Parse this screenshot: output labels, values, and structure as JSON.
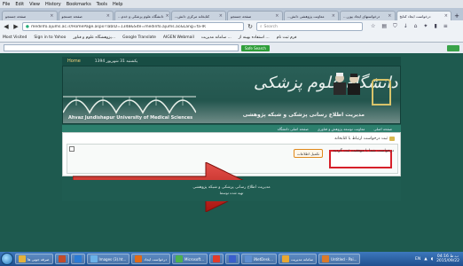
{
  "menu": [
    "File",
    "Edit",
    "View",
    "History",
    "Bookmarks",
    "Tools",
    "Help"
  ],
  "tabs": [
    {
      "label": "صفحه جستجو",
      "active": false
    },
    {
      "label": "صفحه جستجو",
      "active": false
    },
    {
      "label": "...دانشگاه علوم پزشکی و خدم",
      "active": false
    },
    {
      "label": "...کتابخانه مرکزی دانش",
      "active": false
    },
    {
      "label": "صفحه جستجو",
      "active": false
    },
    {
      "label": "...معاونت پژوهشی دانش",
      "active": false
    },
    {
      "label": "...درخواستهای ایجاد یوزر",
      "active": false
    },
    {
      "label": "درخواست ایجاد کتابخ",
      "active": true
    }
  ],
  "tab_new": "+",
  "url": "medinfo.ajums.ac.ir/HomePage.aspx?TabID=1348&Site=medinfo.ajums.ac&Lang=fa-IR",
  "url_host": "medinfo.ajums.ac.ir",
  "search_placeholder": "Search",
  "bookmarks": [
    "Most Visited",
    "Sign in to Yahoo",
    "پژوهشگاه علوم و فناور...",
    "Google Translate",
    "AIGEN Webmail",
    "سامانه مدیریت ...",
    "استفاده بهینه از ...",
    "فرم ثبت نام"
  ],
  "safe_search": "Safe Search",
  "page": {
    "top_strip_home": "Home",
    "date": "یکشنبه 31 شهریور 1394",
    "banner_en": "Ahvaz Jundishapur University of Medical Sciences",
    "banner_fa": "مدیریت اطلاع رسانی پزشکی و شبکه پژوهشی",
    "calligraphy": "دانشگاه علوم پزشکی",
    "nav": [
      "صفحه اصلی",
      "معاونت توسعه پژوهش و فناوری",
      "صفحه اصلی دانشگاه"
    ],
    "breadcrumb": "ثبت درخواست ارتباط با کتابخانه",
    "message": "درخواست شما با موفقیت ثبت گردید",
    "info_button": "تکمیل اطلاعات",
    "footer_line1": "مدیریت اطلاع رسانی پزشکی و شبکه پژوهشی",
    "footer_line2": "تهیه شده توسط"
  },
  "taskbar": {
    "items": [
      {
        "label": "صرفه جویی ها",
        "color": "#e5b23a"
      },
      {
        "label": "",
        "color": "#c24c2a"
      },
      {
        "label": "",
        "color": "#2b7bd5"
      },
      {
        "label": "Images (3).ht...",
        "color": "#6bb2e8"
      },
      {
        "label": "درخواست ایجاد",
        "color": "#e06b18"
      },
      {
        "label": "Microsoft...",
        "color": "#4caf50"
      },
      {
        "label": "",
        "color": "#e23b2b"
      },
      {
        "label": "",
        "color": "#3a5fcd"
      },
      {
        "label": "iNetDesk...",
        "color": "#5e8fd0"
      },
      {
        "label": "سامانه مدیریت",
        "color": "#e7a733"
      },
      {
        "label": "Untitled - Pai...",
        "color": "#d97a2a"
      }
    ],
    "lang": "EN",
    "time": "ب.ظ 04:16",
    "date": "2015/09/22"
  },
  "colors": {
    "page_bg": "#1e5a4f",
    "highlight_red": "#d7202a",
    "arrow": "#c2201c"
  }
}
